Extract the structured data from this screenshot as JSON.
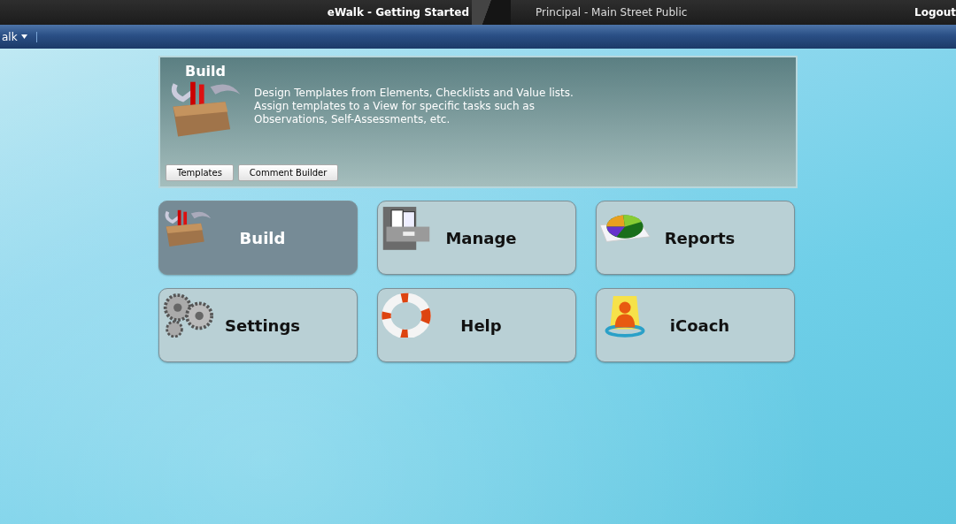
{
  "title_bar": {
    "app_title": "eWalk - Getting Started",
    "context": "Principal - Main Street Public",
    "logout": "Logout"
  },
  "menu_bar": {
    "menu": "alk"
  },
  "panel": {
    "title": "Build",
    "description": [
      "Design Templates from Elements, Checklists and Value lists.",
      "Assign templates to a View for specific tasks such as",
      "Observations, Self-Assessments, etc."
    ],
    "buttons": [
      "Templates",
      "Comment Builder"
    ]
  },
  "tiles": [
    {
      "label": "Build",
      "kind": "toolbox",
      "selected": true
    },
    {
      "label": "Manage",
      "kind": "cabinet",
      "selected": false
    },
    {
      "label": "Reports",
      "kind": "piechart",
      "selected": false
    },
    {
      "label": "Settings",
      "kind": "gears",
      "selected": false
    },
    {
      "label": "Help",
      "kind": "lifebuoy",
      "selected": false
    },
    {
      "label": "iCoach",
      "kind": "person",
      "selected": false
    }
  ]
}
